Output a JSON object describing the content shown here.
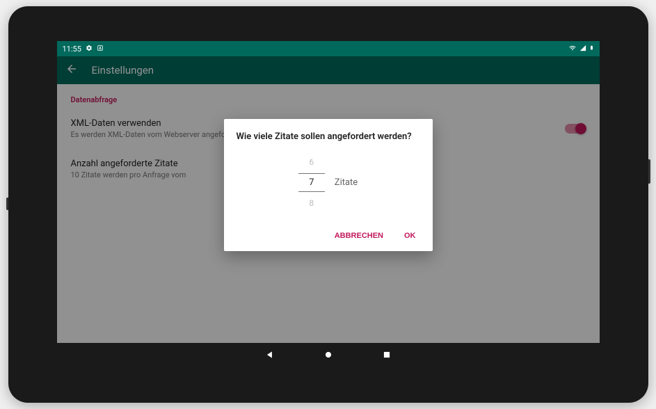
{
  "status": {
    "time": "11:55"
  },
  "app_bar": {
    "title": "Einstellungen"
  },
  "settings": {
    "section_header": "Datenabfrage",
    "xml_data": {
      "title": "XML-Daten verwenden",
      "subtitle": "Es werden XML-Daten vom Webserver angefordert."
    },
    "quote_count": {
      "title": "Anzahl angeforderte Zitate",
      "subtitle": "10 Zitate werden pro Anfrage vom"
    }
  },
  "dialog": {
    "title": "Wie viele Zitate sollen angefordert werden?",
    "picker": {
      "prev": "6",
      "selected": "7",
      "next": "8",
      "unit": "Zitate"
    },
    "actions": {
      "cancel": "Abbrechen",
      "ok": "OK"
    }
  }
}
